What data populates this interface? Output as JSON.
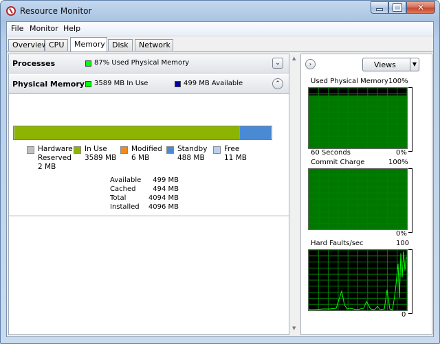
{
  "window": {
    "title": "Resource Monitor"
  },
  "menu": {
    "file": "File",
    "monitor": "Monitor",
    "help": "Help"
  },
  "tabs": [
    {
      "label": "Overview"
    },
    {
      "label": "CPU"
    },
    {
      "label": "Memory"
    },
    {
      "label": "Disk"
    },
    {
      "label": "Network"
    }
  ],
  "active_tab": "Memory",
  "processes": {
    "title": "Processes",
    "info": "87% Used Physical Memory",
    "indicator_color": "#00ff00"
  },
  "physical_memory": {
    "title": "Physical Memory",
    "in_use_info": "3589 MB In Use",
    "in_use_color": "#00ff00",
    "available_info": "499 MB Available",
    "available_color": "#0000b0",
    "bar": {
      "segments": [
        {
          "name": "hardware-reserved",
          "mb": 2,
          "color": "#c0c0c0"
        },
        {
          "name": "in-use",
          "mb": 3589,
          "color": "#8cb400"
        },
        {
          "name": "modified",
          "mb": 6,
          "color": "#ef8a1c"
        },
        {
          "name": "standby",
          "mb": 488,
          "color": "#4a8ad4"
        },
        {
          "name": "free",
          "mb": 11,
          "color": "#b7d0f0"
        }
      ]
    },
    "legend": [
      {
        "label": "Hardware Reserved",
        "line1": "Hardware",
        "line2": "Reserved",
        "value": "2 MB",
        "color": "#c0c0c0"
      },
      {
        "label": "In Use",
        "value": "3589 MB",
        "color": "#8cb400"
      },
      {
        "label": "Modified",
        "value": "6 MB",
        "color": "#ef8a1c"
      },
      {
        "label": "Standby",
        "value": "488 MB",
        "color": "#4a8ad4"
      },
      {
        "label": "Free",
        "value": "11 MB",
        "color": "#b7d0f0"
      }
    ],
    "stats": [
      {
        "label": "Available",
        "value": "499 MB"
      },
      {
        "label": "Cached",
        "value": "494 MB"
      },
      {
        "label": "Total",
        "value": "4094 MB"
      },
      {
        "label": "Installed",
        "value": "4096 MB"
      }
    ]
  },
  "right_panel": {
    "views_label": "Views",
    "graphs": [
      {
        "title": "Used Physical Memory",
        "max_label": "100%",
        "bottom_left": "60 Seconds",
        "min_label": "0%"
      },
      {
        "title": "Commit Charge",
        "max_label": "100%",
        "min_label": "0%"
      },
      {
        "title": "Hard Faults/sec",
        "max_label": "100",
        "min_label": "0"
      }
    ]
  },
  "colors": {
    "graph_line": "#00ff00",
    "graph_grid": "#008000"
  }
}
